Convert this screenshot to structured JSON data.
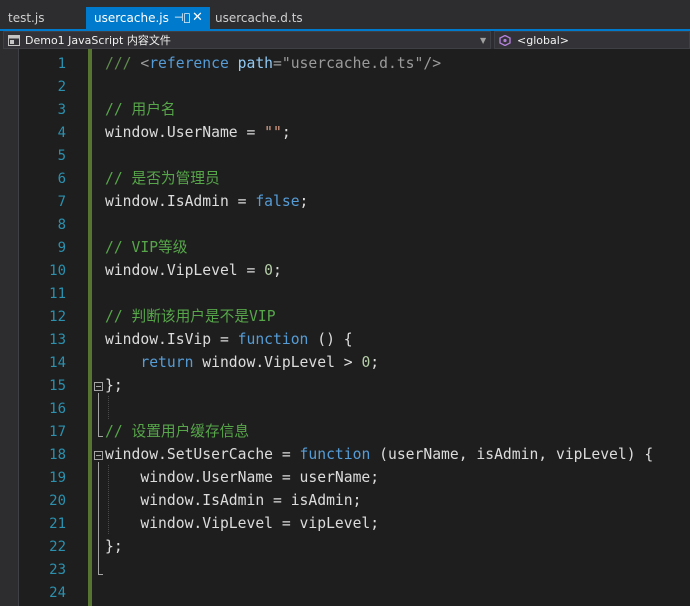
{
  "tabs": {
    "test": "test.js",
    "active": "usercache.js",
    "dts": "usercache.d.ts"
  },
  "nav": {
    "project": "Demo1 JavaScript 内容文件",
    "scope": "<global>"
  },
  "lines": [
    {
      "n": "1",
      "tokens": [
        {
          "t": "///",
          "c": "cmd"
        },
        {
          "t": " <",
          "c": "xml"
        },
        {
          "t": "reference",
          "c": "kw"
        },
        {
          "t": " ",
          "c": "xml"
        },
        {
          "t": "path",
          "c": "attr"
        },
        {
          "t": "=\"usercache.d.ts\"/>",
          "c": "xml"
        }
      ]
    },
    {
      "n": "2",
      "tokens": []
    },
    {
      "n": "3",
      "tokens": [
        {
          "t": "// 用户名",
          "c": "cm"
        }
      ]
    },
    {
      "n": "4",
      "tokens": [
        {
          "t": "window.UserName = ",
          "c": "p"
        },
        {
          "t": "\"\"",
          "c": "str"
        },
        {
          "t": ";",
          "c": "p"
        }
      ]
    },
    {
      "n": "5",
      "tokens": []
    },
    {
      "n": "6",
      "tokens": [
        {
          "t": "// 是否为管理员",
          "c": "cm"
        }
      ]
    },
    {
      "n": "7",
      "tokens": [
        {
          "t": "window.IsAdmin = ",
          "c": "p"
        },
        {
          "t": "false",
          "c": "kw"
        },
        {
          "t": ";",
          "c": "p"
        }
      ]
    },
    {
      "n": "8",
      "tokens": []
    },
    {
      "n": "9",
      "tokens": [
        {
          "t": "// VIP等级",
          "c": "cm"
        }
      ]
    },
    {
      "n": "10",
      "tokens": [
        {
          "t": "window.VipLevel = ",
          "c": "p"
        },
        {
          "t": "0",
          "c": "num"
        },
        {
          "t": ";",
          "c": "p"
        }
      ]
    },
    {
      "n": "11",
      "tokens": []
    },
    {
      "n": "12",
      "tokens": [
        {
          "t": "// 判断该用户是不是VIP",
          "c": "cm"
        }
      ]
    },
    {
      "n": "13",
      "tokens": [
        {
          "t": "window.IsVip = ",
          "c": "p"
        },
        {
          "t": "function",
          "c": "kw"
        },
        {
          "t": " () {",
          "c": "p"
        }
      ]
    },
    {
      "n": "14",
      "tokens": [
        {
          "t": "    ",
          "c": "p"
        },
        {
          "t": "return",
          "c": "kw"
        },
        {
          "t": " window.VipLevel > ",
          "c": "p"
        },
        {
          "t": "0",
          "c": "num"
        },
        {
          "t": ";",
          "c": "p"
        }
      ]
    },
    {
      "n": "15",
      "tokens": [
        {
          "t": "};",
          "c": "p"
        }
      ]
    },
    {
      "n": "16",
      "tokens": []
    },
    {
      "n": "17",
      "tokens": [
        {
          "t": "// 设置用户缓存信息",
          "c": "cm"
        }
      ]
    },
    {
      "n": "18",
      "tokens": [
        {
          "t": "window.SetUserCache = ",
          "c": "p"
        },
        {
          "t": "function",
          "c": "kw"
        },
        {
          "t": " (userName, isAdmin, vipLevel) {",
          "c": "p"
        }
      ]
    },
    {
      "n": "19",
      "tokens": [
        {
          "t": "    window.UserName = userName;",
          "c": "p"
        }
      ]
    },
    {
      "n": "20",
      "tokens": [
        {
          "t": "    window.IsAdmin = isAdmin;",
          "c": "p"
        }
      ]
    },
    {
      "n": "21",
      "tokens": [
        {
          "t": "    window.VipLevel = vipLevel;",
          "c": "p"
        }
      ]
    },
    {
      "n": "22",
      "tokens": [
        {
          "t": "};",
          "c": "p"
        }
      ]
    },
    {
      "n": "23",
      "tokens": []
    },
    {
      "n": "24",
      "tokens": []
    }
  ],
  "colors": {
    "accent": "#007acc",
    "keyword": "#569cd6",
    "comment": "#57a64a",
    "string": "#d69d85",
    "number": "#b5cea8",
    "line_number": "#2b91af",
    "change_marker": "#577430"
  }
}
